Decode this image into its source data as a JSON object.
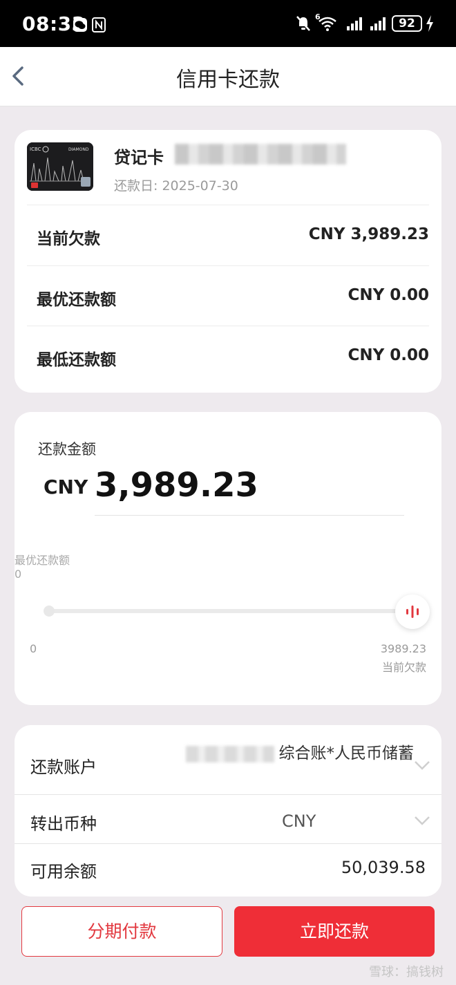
{
  "status_bar": {
    "time": "08:33",
    "network_label": "6",
    "battery": "92"
  },
  "nav": {
    "title": "信用卡还款",
    "back_icon": "chevron-left-icon"
  },
  "card": {
    "name": "贷记卡",
    "due_date": "还款日: 2025-07-30",
    "thumb_brand": "ICBC",
    "thumb_series": "DIAMOND"
  },
  "summary": [
    {
      "label": "当前欠款",
      "value": "CNY 3,989.23"
    },
    {
      "label": "最优还款额",
      "value": "CNY 0.00"
    },
    {
      "label": "最低还款额",
      "value": "CNY 0.00"
    }
  ],
  "amount": {
    "label": "还款金额",
    "currency": "CNY",
    "value": "3,989.23",
    "tip_label": "最优还款额",
    "tip_value": "0",
    "slider_min": "0",
    "slider_max": "3989.23",
    "slider_max_caption": "当前欠款",
    "slider_fraction": 1.0
  },
  "account": {
    "repay_account_label": "还款账户",
    "repay_account_value": "综合账*人民币储蓄",
    "currency_label": "转出币种",
    "currency_value": "CNY",
    "balance_label": "可用余额",
    "balance_value": "50,039.58"
  },
  "buttons": {
    "installment": "分期付款",
    "repay_now": "立即还款"
  },
  "colors": {
    "accent": "#ef2e37",
    "background": "#eeeaee"
  },
  "watermark": "雪球：搞钱树"
}
